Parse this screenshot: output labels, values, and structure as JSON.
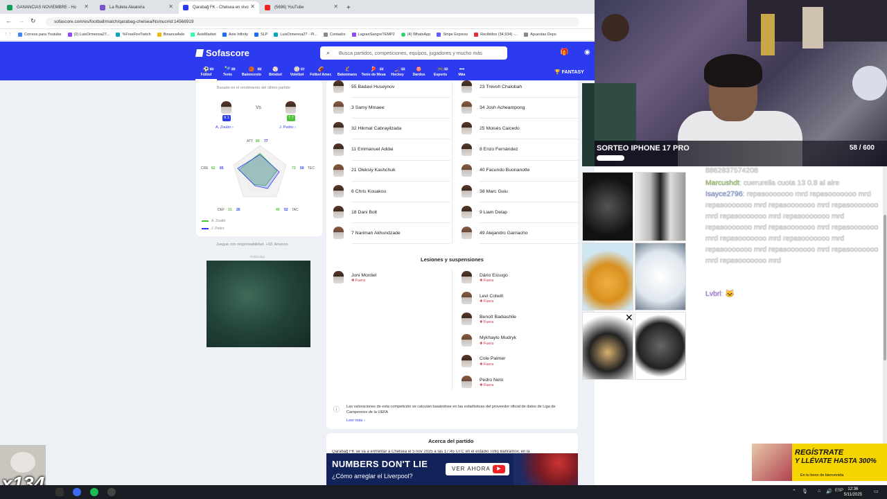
{
  "browser": {
    "tabs": [
      {
        "label": "GANANCIAS NOVIEMBRE - Ho",
        "color": "#0f9d58"
      },
      {
        "label": "La Ruleta Aleatoria",
        "color": "#7a52c7"
      },
      {
        "label": "Qarabağ FK - Chelsea en vivo",
        "color": "#2c3bf0"
      },
      {
        "label": "(5696) YouTube",
        "color": "#e22"
      }
    ],
    "url": "sofascore.com/es/football/match/qarabag-chelsea/Nsmuc#id:14566919",
    "bookmarks": [
      "Correos para Youtube",
      "(2) LuisOrmenoa27...",
      "%FreeFireTwitch",
      "BinanceAxie",
      "AxieMarket",
      "Axie Infinity",
      "SLP",
      "LuisOrmenoa27 - Pl...",
      "Contador",
      "LagranSangreTEMP2",
      "(4) WhatsApp",
      "Stripe Express",
      "Recibidos (34,934) -...",
      "Apuestas Depo"
    ]
  },
  "header": {
    "logo": "Sofascore",
    "search_placeholder": "Busca partidos, competiciones, equipos, jugadores y mucho más",
    "fantasy": "FANTASY",
    "sports": [
      {
        "label": "Fútbol",
        "count": "62",
        "icon": "⚽"
      },
      {
        "label": "Tenis",
        "count": "29",
        "icon": "🎾"
      },
      {
        "label": "Baloncesto",
        "count": "52",
        "icon": "🏀"
      },
      {
        "label": "Béisbol",
        "count": "",
        "icon": "⚾"
      },
      {
        "label": "Voleibol",
        "count": "17",
        "icon": "🏐"
      },
      {
        "label": "Fútbol Amer.",
        "count": "",
        "icon": "🏈"
      },
      {
        "label": "Balonmano",
        "count": "",
        "icon": "🤾"
      },
      {
        "label": "Tenis de Mesa",
        "count": "12",
        "icon": "🏓"
      },
      {
        "label": "Hockey",
        "count": "13",
        "icon": "🏒"
      },
      {
        "label": "Dardos",
        "count": "",
        "icon": "🎯"
      },
      {
        "label": "Esports",
        "count": "12",
        "icon": "🎮"
      },
      {
        "label": "Más",
        "count": "",
        "icon": "•••"
      }
    ]
  },
  "comparison": {
    "subtitle": "Basado en el rendimiento del último partido",
    "vs": "Vs",
    "player1": {
      "name": "A. Zoubir",
      "rating": "9.1",
      "color": "#2c3bf0"
    },
    "player2": {
      "name": "J. Pedro",
      "rating": "7.7",
      "color": "#4fc23b"
    },
    "radar": {
      "att_label": "ATT",
      "att1": "80",
      "att2": "77",
      "tec_label": "TEC",
      "tec1": "73",
      "tec2": "59",
      "tac_label": "TAC",
      "tac1": "40",
      "tac2": "52",
      "def_label": "DEF",
      "def1": "31",
      "def2": "26",
      "cre_label": "CRE",
      "cre1": "62",
      "cre2": "65"
    },
    "legend1": "A. Zoubir",
    "legend2": "J. Pedro",
    "responsible": "Juegue con responsabilidad. +18. Anuncio",
    "ad_label": "Publicidad"
  },
  "lineups": {
    "left": [
      "55 Badavi Huseynov",
      "3 Samy Mmaee",
      "32 Hikmat Cabrayilzada",
      "11 Emmanuel Addai",
      "21 Oleksiy Kashchuk",
      "6 Chris Kouakou",
      "18 Dani Bolt",
      "7 Nariman Akhundzade"
    ],
    "right": [
      "23 Trevoh Chalobah",
      "34 Josh Acheampong",
      "25 Moisés Caicedo",
      "8 Enzo Fernández",
      "40 Facundo Buonanotte",
      "38 Marc Guiu",
      "9 Liam Delap",
      "49 Alejandro Garnacho"
    ]
  },
  "injuries": {
    "title": "Lesiones y suspensiones",
    "status": "Fuera",
    "left": [
      "Joni Montiel"
    ],
    "right": [
      "Dário Essugo",
      "Levi Colwill",
      "Benoît Badiashile",
      "Mykhaylo Mudryk",
      "Cole Palmer",
      "Pedro Neto"
    ]
  },
  "note": {
    "text": "Las valoraciones de esta competición se calculan basándose en las estadísticas del proveedor oficial de datos de Liga de Campeones de la UEFA",
    "link": "Leer más"
  },
  "about": {
    "title": "Acerca del partido",
    "text": "Qarabağ FK se va a enfrentar a Chelsea el 5 nov 2025 a las 17:45 UTC en el estadio Tofiq Bahramov, en la"
  },
  "ad_banner": {
    "line1": "NUMBERS DON'T LIE",
    "line2": "¿Cómo arreglar el Liverpool?",
    "button": "VER AHORA"
  },
  "stream": {
    "sorteo": "SORTEO IPHONE 17 PRO",
    "count": "58 / 600",
    "multiplier": "x134",
    "promo_line1": "REGÍSTRATE",
    "promo_line2": "Y LLÉVATE HASTA 300%",
    "promo_line3": "En tu bono de bienvenida"
  },
  "chat": {
    "top": "8862837574208",
    "lines": [
      {
        "user": "Marcushdt",
        "msg": ": cuerurella cuota 13 0.8 al aire"
      },
      {
        "user": "Isayce2796",
        "msg": ": repasooooooo mrd repasooooooo mrd repasooooooo mrd repasooooooo mrd repasooooooo mrd repasooooooo mrd repasooooooo mrd repasooooooo mrd repasooooooo mrd repasooooooo mrd repasooooooo mrd repasooooooo mrd repasooooooo mrd repasooooooo mrd repasooooooo mrd repasooooooo mrd"
      },
      {
        "user": "Lvbrl",
        "msg": ": 🐱"
      }
    ]
  },
  "taskbar": {
    "lang": "ESP",
    "time": "12:36",
    "date": "5/11/2025"
  }
}
